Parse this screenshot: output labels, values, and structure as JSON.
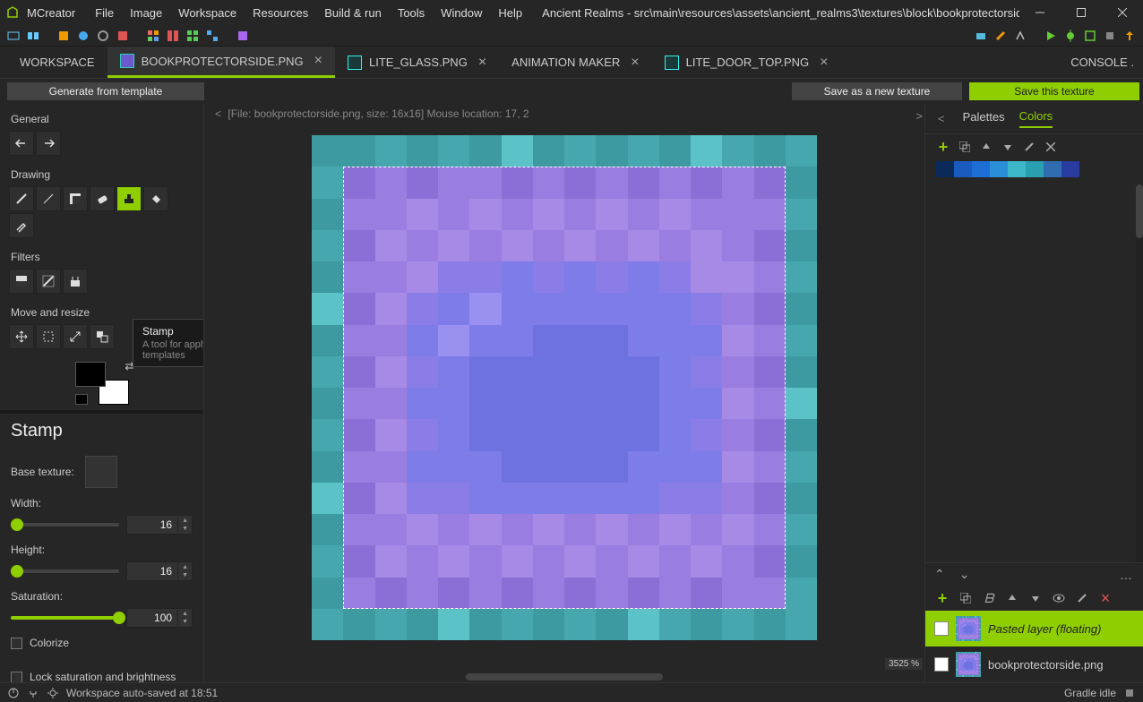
{
  "app": {
    "name": "MCreator",
    "title": "Ancient Realms - src\\main\\resources\\assets\\ancient_realms3\\textures\\block\\bookprotectorside.png - MCrea..."
  },
  "menu": [
    "File",
    "Image",
    "Workspace",
    "Resources",
    "Build & run",
    "Tools",
    "Window",
    "Help"
  ],
  "tabs": {
    "workspace": "WORKSPACE",
    "items": [
      {
        "label": "BOOKPROTECTORSIDE.PNG",
        "active": true
      },
      {
        "label": "LITE_GLASS.PNG",
        "active": false
      },
      {
        "label": "ANIMATION MAKER",
        "active": false,
        "noicon": true
      },
      {
        "label": "LITE_DOOR_TOP.PNG",
        "active": false
      }
    ],
    "console": "CONSOLE"
  },
  "actions": {
    "generate": "Generate from template",
    "save_new": "Save as a new texture",
    "save": "Save this texture"
  },
  "info": {
    "file": "[File: bookprotectorside.png, size: 16x16] Mouse location: 17, 2"
  },
  "left": {
    "general": "General",
    "drawing": "Drawing",
    "filters": "Filters",
    "move": "Move and resize"
  },
  "tooltip": {
    "title": "Stamp",
    "desc": "A tool for applying textures from templates"
  },
  "props": {
    "title": "Stamp",
    "base": "Base texture:",
    "width": "Width:",
    "width_val": "16",
    "height": "Height:",
    "height_val": "16",
    "saturation": "Saturation:",
    "saturation_val": "100",
    "colorize": "Colorize",
    "lock": "Lock saturation and brightness"
  },
  "right": {
    "palettes": "Palettes",
    "colors": "Colors",
    "swatches": [
      "#0a2a5a",
      "#1a5bbf",
      "#1d6fd6",
      "#2a8fd6",
      "#3cb8c9",
      "#2a9fb0",
      "#2f6db0",
      "#2a3ba0"
    ]
  },
  "layers": {
    "items": [
      {
        "name": "Pasted layer (floating)",
        "active": true
      },
      {
        "name": "bookprotectorside.png",
        "active": false
      }
    ]
  },
  "status": {
    "autosave": "Workspace auto-saved at 18:51",
    "gradle": "Gradle idle",
    "zoom": "3525 %"
  },
  "texture": [
    [
      "#3c9aa0",
      "#3c9aa0",
      "#46a8ae",
      "#3c9aa0",
      "#46a8ae",
      "#3c9aa0",
      "#5bc2c8",
      "#3c9aa0",
      "#46a8ae",
      "#3c9aa0",
      "#46a8ae",
      "#3c9aa0",
      "#5bc2c8",
      "#46a8ae",
      "#3c9aa0",
      "#46a8ae"
    ],
    [
      "#46a8ae",
      "#8b6fd6",
      "#9a7de0",
      "#8b6fd6",
      "#9a7de0",
      "#9a7de0",
      "#8b6fd6",
      "#9a7de0",
      "#8b6fd6",
      "#9a7de0",
      "#8b6fd6",
      "#9a7de0",
      "#8b6fd6",
      "#9a7de0",
      "#8b6fd6",
      "#3c9aa0"
    ],
    [
      "#3c9aa0",
      "#9a7de0",
      "#9a7de0",
      "#a68ae6",
      "#9a7de0",
      "#a68ae6",
      "#9a7de0",
      "#a68ae6",
      "#9a7de0",
      "#a68ae6",
      "#9a7de0",
      "#a68ae6",
      "#9a7de0",
      "#9a7de0",
      "#9a7de0",
      "#46a8ae"
    ],
    [
      "#46a8ae",
      "#8b6fd6",
      "#a68ae6",
      "#9a7de0",
      "#a68ae6",
      "#9a7de0",
      "#a68ae6",
      "#9a7de0",
      "#a68ae6",
      "#9a7de0",
      "#a68ae6",
      "#9a7de0",
      "#a68ae6",
      "#9a7de0",
      "#8b6fd6",
      "#3c9aa0"
    ],
    [
      "#3c9aa0",
      "#9a7de0",
      "#9a7de0",
      "#a68ae6",
      "#8b7de8",
      "#8b7de8",
      "#7d7ce8",
      "#8b7de8",
      "#7d7ce8",
      "#8b7de8",
      "#7d7ce8",
      "#8b7de8",
      "#a68ae6",
      "#a68ae6",
      "#9a7de0",
      "#46a8ae"
    ],
    [
      "#5bc2c8",
      "#8b6fd6",
      "#a68ae6",
      "#8b7de8",
      "#7d7ce8",
      "#9a90f0",
      "#7d7ce8",
      "#7d7ce8",
      "#7d7ce8",
      "#7d7ce8",
      "#7d7ce8",
      "#7d7ce8",
      "#8b7de8",
      "#9a7de0",
      "#8b6fd6",
      "#3c9aa0"
    ],
    [
      "#3c9aa0",
      "#9a7de0",
      "#9a7de0",
      "#7d7ce8",
      "#9a90f0",
      "#7d7ce8",
      "#7d7ce8",
      "#6d72e0",
      "#6d72e0",
      "#6d72e0",
      "#7d7ce8",
      "#7d7ce8",
      "#7d7ce8",
      "#a68ae6",
      "#9a7de0",
      "#46a8ae"
    ],
    [
      "#46a8ae",
      "#8b6fd6",
      "#a68ae6",
      "#8b7de8",
      "#7d7ce8",
      "#6d72e0",
      "#6d72e0",
      "#6d72e0",
      "#6d72e0",
      "#6d72e0",
      "#6d72e0",
      "#7d7ce8",
      "#8b7de8",
      "#9a7de0",
      "#8b6fd6",
      "#3c9aa0"
    ],
    [
      "#3c9aa0",
      "#9a7de0",
      "#9a7de0",
      "#7d7ce8",
      "#7d7ce8",
      "#6d72e0",
      "#6d72e0",
      "#6d72e0",
      "#6d72e0",
      "#6d72e0",
      "#6d72e0",
      "#7d7ce8",
      "#7d7ce8",
      "#a68ae6",
      "#9a7de0",
      "#5bc2c8"
    ],
    [
      "#46a8ae",
      "#8b6fd6",
      "#a68ae6",
      "#8b7de8",
      "#7d7ce8",
      "#6d72e0",
      "#6d72e0",
      "#6d72e0",
      "#6d72e0",
      "#6d72e0",
      "#6d72e0",
      "#7d7ce8",
      "#8b7de8",
      "#9a7de0",
      "#8b6fd6",
      "#3c9aa0"
    ],
    [
      "#3c9aa0",
      "#9a7de0",
      "#9a7de0",
      "#7d7ce8",
      "#7d7ce8",
      "#7d7ce8",
      "#6d72e0",
      "#6d72e0",
      "#6d72e0",
      "#6d72e0",
      "#7d7ce8",
      "#7d7ce8",
      "#7d7ce8",
      "#a68ae6",
      "#9a7de0",
      "#46a8ae"
    ],
    [
      "#5bc2c8",
      "#8b6fd6",
      "#a68ae6",
      "#8b7de8",
      "#8b7de8",
      "#7d7ce8",
      "#7d7ce8",
      "#7d7ce8",
      "#7d7ce8",
      "#7d7ce8",
      "#7d7ce8",
      "#8b7de8",
      "#8b7de8",
      "#9a7de0",
      "#8b6fd6",
      "#3c9aa0"
    ],
    [
      "#3c9aa0",
      "#9a7de0",
      "#9a7de0",
      "#a68ae6",
      "#9a7de0",
      "#a68ae6",
      "#9a7de0",
      "#a68ae6",
      "#9a7de0",
      "#a68ae6",
      "#9a7de0",
      "#a68ae6",
      "#9a7de0",
      "#a68ae6",
      "#9a7de0",
      "#46a8ae"
    ],
    [
      "#46a8ae",
      "#8b6fd6",
      "#a68ae6",
      "#9a7de0",
      "#a68ae6",
      "#9a7de0",
      "#a68ae6",
      "#9a7de0",
      "#a68ae6",
      "#9a7de0",
      "#a68ae6",
      "#9a7de0",
      "#a68ae6",
      "#9a7de0",
      "#8b6fd6",
      "#3c9aa0"
    ],
    [
      "#3c9aa0",
      "#9a7de0",
      "#8b6fd6",
      "#9a7de0",
      "#8b6fd6",
      "#9a7de0",
      "#8b6fd6",
      "#9a7de0",
      "#8b6fd6",
      "#9a7de0",
      "#8b6fd6",
      "#9a7de0",
      "#8b6fd6",
      "#9a7de0",
      "#9a7de0",
      "#46a8ae"
    ],
    [
      "#46a8ae",
      "#3c9aa0",
      "#46a8ae",
      "#3c9aa0",
      "#5bc2c8",
      "#3c9aa0",
      "#46a8ae",
      "#3c9aa0",
      "#46a8ae",
      "#3c9aa0",
      "#5bc2c8",
      "#46a8ae",
      "#3c9aa0",
      "#46a8ae",
      "#3c9aa0",
      "#46a8ae"
    ]
  ]
}
